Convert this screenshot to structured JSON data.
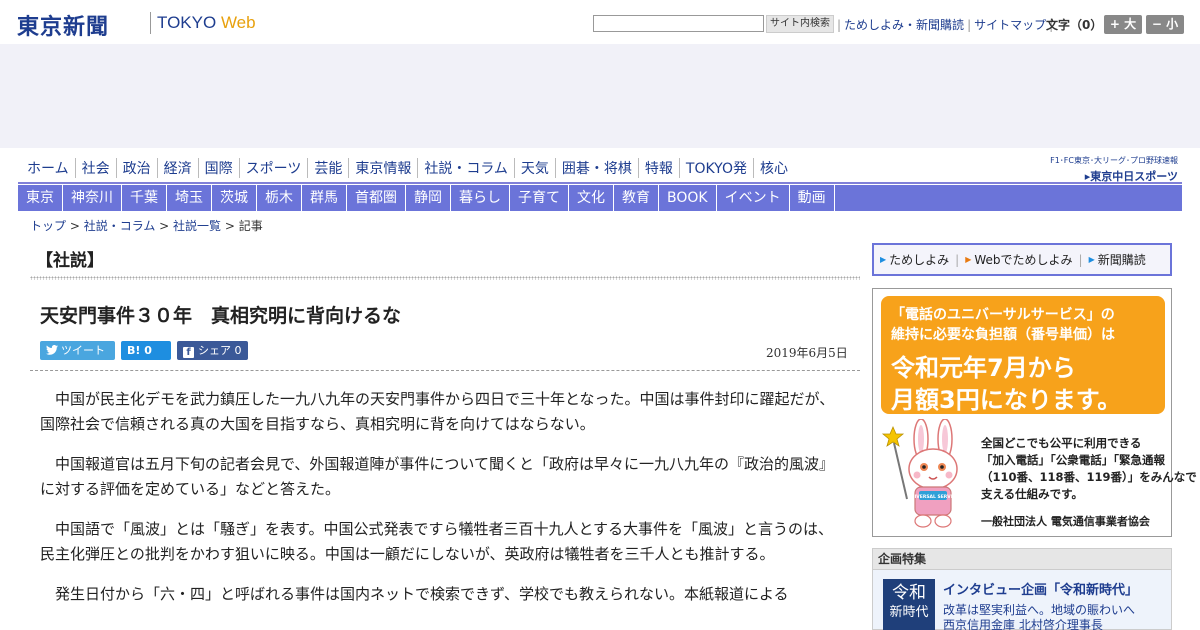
{
  "header": {
    "logo_jp": "東京新聞",
    "logo_en_main": "TOKYO ",
    "logo_en_web": "Web",
    "search_button": "サイト内検索",
    "links": [
      "ためしよみ・新聞購読",
      "サイトマップ"
    ],
    "font_size_label": "文字（0）",
    "font_bigger": "+ 大",
    "font_smaller": "− 小"
  },
  "global_nav": [
    "ホーム",
    "社会",
    "政治",
    "経済",
    "国際",
    "スポーツ",
    "芸能",
    "東京情報",
    "社説・コラム",
    "天気",
    "囲碁・将棋",
    "特報",
    "TOKYO発",
    "核心"
  ],
  "chunichi": {
    "tagline": "F1･FC東京･大リーグ･プロ野球速報",
    "logo": "▸東京中日スポーツ"
  },
  "regional_nav": [
    "東京",
    "神奈川",
    "千葉",
    "埼玉",
    "茨城",
    "栃木",
    "群馬",
    "首都圏",
    "静岡",
    "暮らし",
    "子育て",
    "文化",
    "教育",
    "BOOK",
    "イベント",
    "動画"
  ],
  "breadcrumb": {
    "items": [
      "トップ",
      "社説・コラム",
      "社説一覧"
    ],
    "current": "記事",
    "sep": " > "
  },
  "article": {
    "section": "【社説】",
    "headline": "天安門事件３０年　真相究明に背向けるな",
    "share_tweet": "ツイート",
    "share_hatena": "B!  0",
    "share_facebook": "シェア 0",
    "date": "2019年6月5日",
    "paragraphs": [
      "中国が民主化デモを武力鎮圧した一九八九年の天安門事件から四日で三十年となった。中国は事件封印に躍起だが、国際社会で信頼される真の大国を目指すなら、真相究明に背を向けてはならない。",
      "中国報道官は五月下旬の記者会見で、外国報道陣が事件について聞くと「政府は早々に一九八九年の『政治的風波』に対する評価を定めている」などと答えた。",
      "中国語で「風波」とは「騒ぎ」を表す。中国公式発表ですら犠牲者三百十九人とする大事件を「風波」と言うのは、民主化弾圧との批判をかわす狙いに映る。中国は一顧だにしないが、英政府は犠牲者を三千人とも推計する。",
      "発生日付から「六・四」と呼ばれる事件は国内ネットで検索できず、学校でも教えられない。本紙報道による"
    ]
  },
  "sidebar": {
    "subscribe": [
      "ためしよみ",
      "Webでためしよみ",
      "新聞購読"
    ],
    "ad": {
      "line1": "「電話のユニバーサルサービス」の",
      "line2": "維持に必要な負担額（番号単価）は",
      "line3": "令和元年7月から",
      "line4": "月額3円になります。",
      "small": [
        "全国どこでも公平に利用できる",
        "「加入電話」「公衆電話」「緊急通報",
        "（110番、118番、119番）」をみんなで",
        "支える仕組みです。"
      ],
      "org": "一般社団法人 電気通信事業者協会",
      "mascot_badge": "UNIVERSAL SERVICE"
    },
    "feature_heading": "企画特集",
    "feature": {
      "thumb_line1": "令和",
      "thumb_line2": "新時代",
      "title": "インタビュー企画「令和新時代」",
      "sub_line1": "改革は堅実利益へ。地域の賑わいへ",
      "sub_line2": "西京信用金庫 北村啓介理事長"
    }
  }
}
